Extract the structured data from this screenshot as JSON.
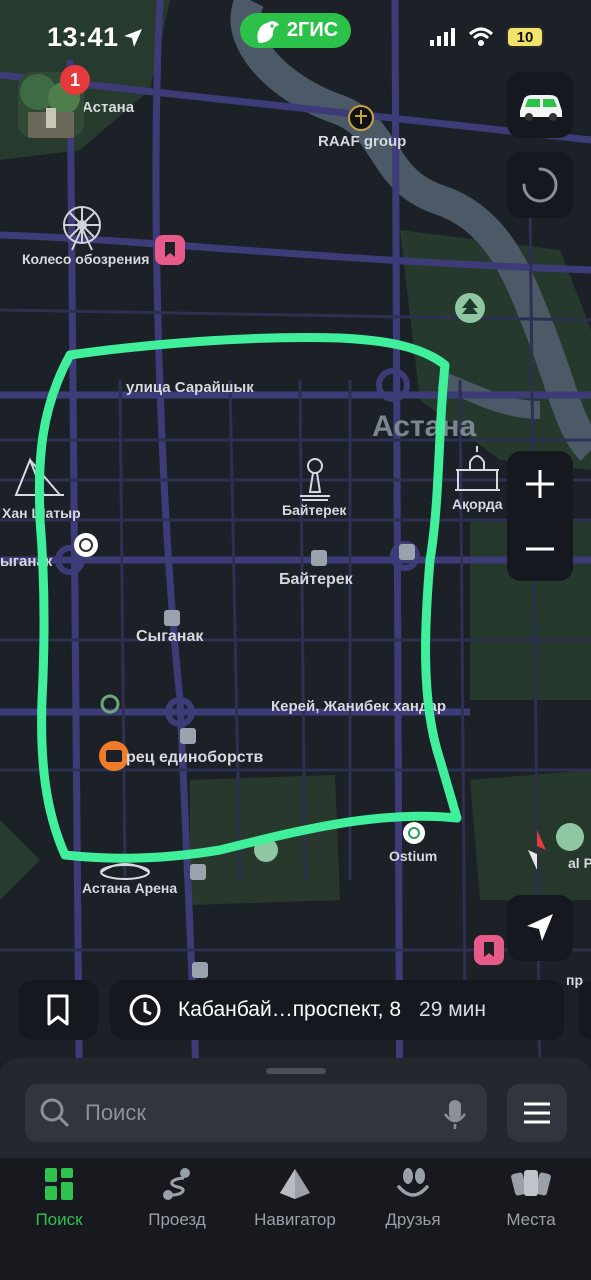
{
  "status_bar": {
    "time": "13:41",
    "battery": "10"
  },
  "brand": {
    "name": "2ГИС"
  },
  "avatar": {
    "badge": "1"
  },
  "map": {
    "labels": {
      "astana_top": "Астана",
      "raaf": "RAAF group",
      "ferris": "Колесо обозрения",
      "saraishyk": "улица Сарайшык",
      "astana_big": "Астана",
      "han_shatyr": "Хан Шатыр",
      "syganak_left": "ыганак",
      "baiterek_monument": "Байтерек",
      "baiterek_station": "Байтерек",
      "akorda": "Ақорда",
      "syganak": "Сыганак",
      "kerei": "Керей, Жанибек хандар",
      "palace": "рец единоборств",
      "ostium": "Ostium",
      "arena": "Астана Арена",
      "right_cut": "al Pa",
      "right_cut2": "пр"
    }
  },
  "route": {
    "address": "Кабанбай…проспект, 8",
    "eta": "29 мин"
  },
  "search": {
    "placeholder": "Поиск"
  },
  "tabs": [
    {
      "label": "Поиск"
    },
    {
      "label": "Проезд"
    },
    {
      "label": "Навигатор"
    },
    {
      "label": "Друзья"
    },
    {
      "label": "Места"
    }
  ],
  "colors": {
    "accent": "#2fc24e",
    "annotation": "#3fef9a",
    "map_bg": "#1c2128",
    "river": "#4b5a66",
    "road": "#3f3f7a"
  }
}
